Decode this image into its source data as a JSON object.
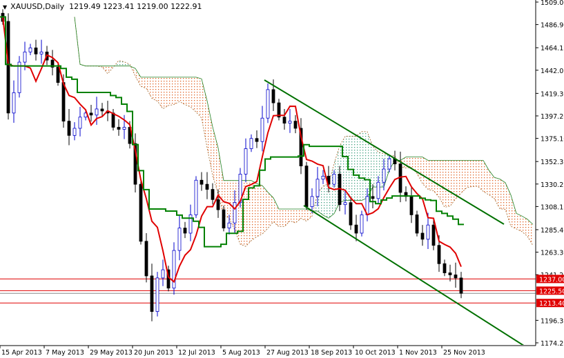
{
  "header": {
    "symbol": "XAUUSD,Daily",
    "ohlc": "1219.49 1223.41 1219.00 1222.91"
  },
  "colors": {
    "bull": "#0000cc",
    "bear": "#000000",
    "tenkan": "#e00000",
    "kijun": "#008000",
    "cloud_bear": "#e06020",
    "cloud_bull": "#40a080",
    "trendline": "#007000",
    "level": "#e00000"
  },
  "chart_data": {
    "type": "candlestick",
    "title": "XAUUSD,Daily",
    "indicator": "Ichimoku Kinko Hyo",
    "x_tick_labels": [
      "15 Apr 2013",
      "7 May 2013",
      "29 May 2013",
      "20 Jun 2013",
      "12 Jul 2013",
      "5 Aug 2013",
      "27 Aug 2013",
      "18 Sep 2013",
      "10 Oct 2013",
      "1 Nov 2013",
      "25 Nov 2013"
    ],
    "y_tick_labels": [
      "1509.00",
      "1486.90",
      "1464.15",
      "1442.05",
      "1419.30",
      "1397.20",
      "1375.10",
      "1352.35",
      "1330.25",
      "1308.15",
      "1285.40",
      "1263.30",
      "1241.20",
      "1196.35",
      "1174.25"
    ],
    "ylim": [
      1174.25,
      1509.0
    ],
    "closes": [
      1490,
      1400,
      1420,
      1450,
      1460,
      1464,
      1458,
      1460,
      1452,
      1445,
      1430,
      1392,
      1378,
      1385,
      1396,
      1400,
      1398,
      1404,
      1402,
      1400,
      1386,
      1384,
      1386,
      1370,
      1330,
      1274,
      1240,
      1205,
      1238,
      1246,
      1228,
      1265,
      1287,
      1282,
      1300,
      1334,
      1330,
      1325,
      1315,
      1305,
      1287,
      1292,
      1312,
      1340,
      1365,
      1375,
      1372,
      1395,
      1423,
      1410,
      1396,
      1390,
      1392,
      1385,
      1348,
      1308,
      1318,
      1335,
      1338,
      1330,
      1340,
      1310,
      1312,
      1290,
      1282,
      1300,
      1318,
      1316,
      1332,
      1345,
      1355,
      1350,
      1322,
      1318,
      1300,
      1282,
      1276,
      1290,
      1270,
      1252,
      1243,
      1241,
      1238,
      1222.91
    ],
    "levels": [
      {
        "label": "1237.00",
        "value": 1237.0
      },
      {
        "label": "1225.50",
        "value": 1225.5
      },
      {
        "label": "1213.40",
        "value": 1213.4
      }
    ],
    "current_price": 1222.91,
    "trendlines": [
      {
        "name": "channel-upper",
        "from": [
          "27 Aug 2013",
          1431
        ],
        "to": [
          "Dec 2013",
          1290
        ]
      },
      {
        "name": "channel-lower",
        "from": [
          "18 Sep 2013",
          1309
        ],
        "to": [
          "Dec 2013",
          1172
        ]
      }
    ]
  }
}
